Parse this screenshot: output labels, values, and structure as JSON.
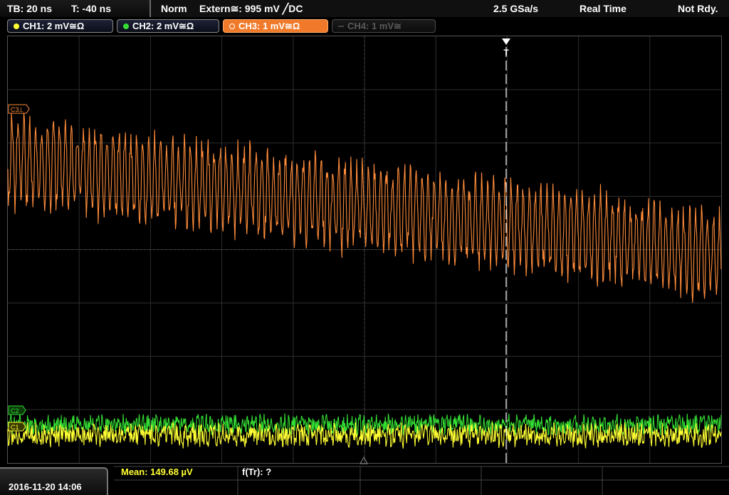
{
  "status_bar": {
    "timebase": "TB: 20 ns",
    "trigger_offset": "T: -40 ns",
    "trigger_mode": "Norm",
    "trigger_source": "Extern≅: 995 mV ╱DC",
    "sample_rate": "2.5 GSa/s",
    "acq_mode": "Real Time",
    "state": "Not Rdy."
  },
  "channels": [
    {
      "label": "CH1: 2 mV≅Ω",
      "color": "#ffff33",
      "active": true
    },
    {
      "label": "CH2: 2 mV≅Ω",
      "color": "#33dd33",
      "active": true
    },
    {
      "label": "CH3: 1 mV≅Ω",
      "color": "#ff8c3a",
      "active": true
    },
    {
      "label": "CH4: 1 mV≅",
      "color": "#555555",
      "active": false
    }
  ],
  "markers": {
    "ch3": "C3⟂",
    "ch2": "C2",
    "ch1": "C1",
    "trigger": "T"
  },
  "measurements": {
    "mean": "Mean: 149.68 µV",
    "freq": "f(Tr): ?"
  },
  "datetime": "2016-11-20 14:06",
  "colors": {
    "grid": "#2e2e2e",
    "ch1": "#ffff33",
    "ch2": "#33dd33",
    "ch3": "#ff8c3a",
    "accent": "#f07a2a"
  },
  "waveforms": {
    "ch3": {
      "start_level": 0.29,
      "end_level": 0.51,
      "amplitude": 0.11,
      "cycles": 120
    },
    "ch2": {
      "level": 0.91,
      "amplitude": 0.022
    },
    "ch1": {
      "level": 0.935,
      "amplitude": 0.026
    }
  }
}
